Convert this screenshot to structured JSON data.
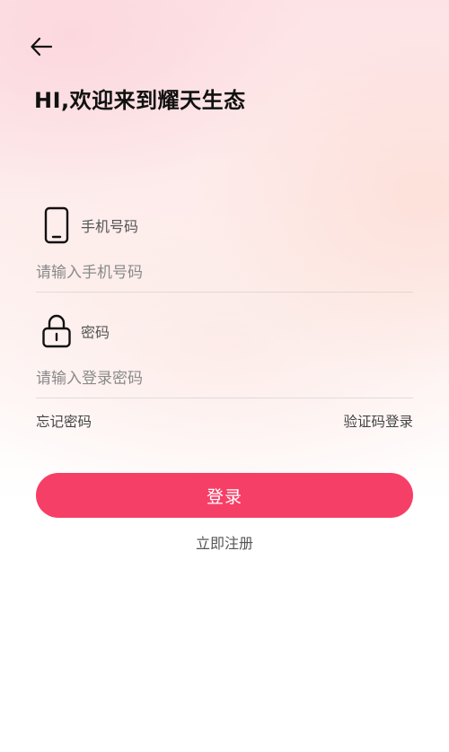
{
  "header": {
    "back_icon": "arrow-left-icon",
    "title": "HI,欢迎来到耀天生态"
  },
  "form": {
    "phone": {
      "icon": "mobile-phone-icon",
      "label": "手机号码",
      "placeholder": "请输入手机号码",
      "value": ""
    },
    "password": {
      "icon": "lock-icon",
      "label": "密码",
      "placeholder": "请输入登录密码",
      "value": ""
    },
    "forgot_password": "忘记密码",
    "code_login": "验证码登录",
    "login_button": "登录",
    "register_link": "立即注册"
  },
  "colors": {
    "accent": "#f63f67",
    "background_top": "#fde3e6",
    "background_bottom": "#ffffff"
  }
}
